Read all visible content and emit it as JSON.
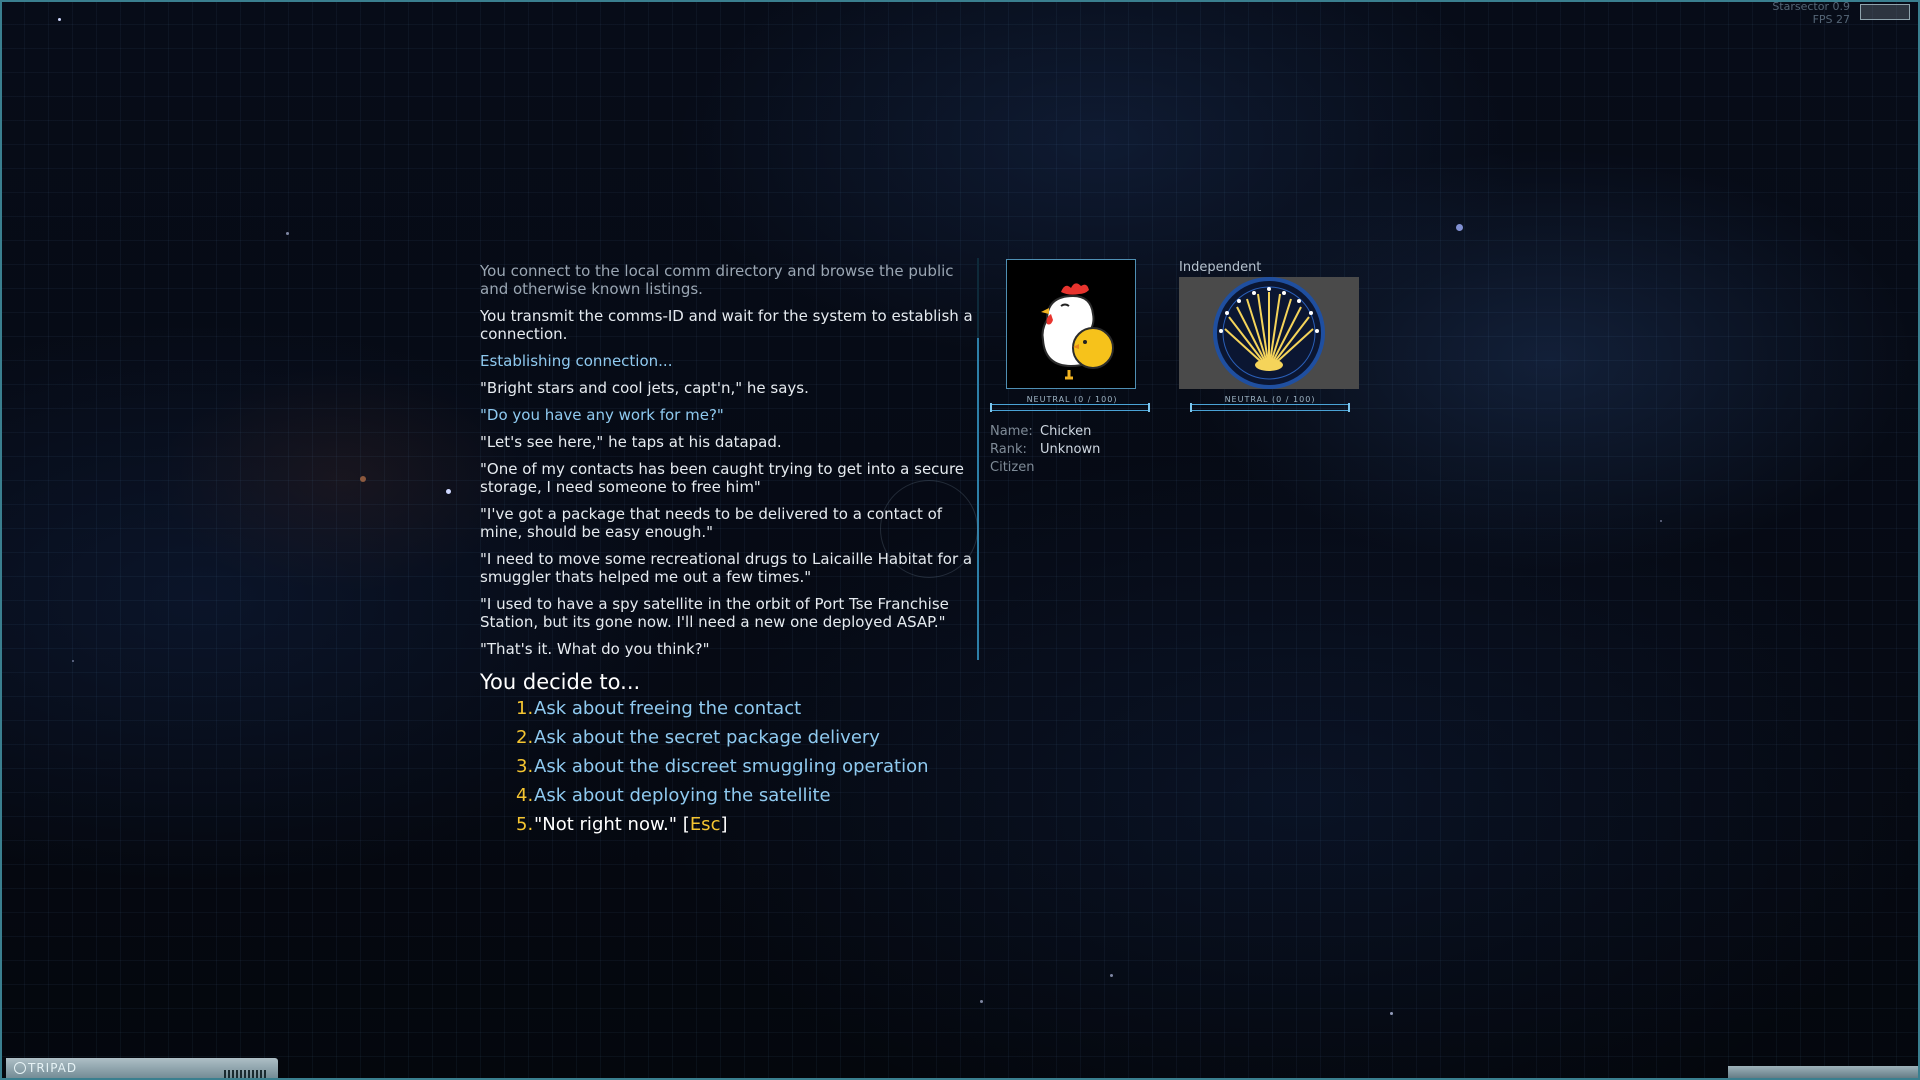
{
  "hud": {
    "debug_line1": "Starsector 0.9",
    "debug_line2": "FPS   27"
  },
  "dialog": {
    "log": [
      {
        "text": "You connect to the local comm directory and browse the public and otherwise known listings.",
        "style": "intro"
      },
      {
        "text": "You transmit the comms-ID and wait for the system to establish a connection.",
        "style": "normal"
      },
      {
        "text": "Establishing connection...",
        "style": "player"
      },
      {
        "text": "\"Bright stars and cool jets, capt'n,\" he says.",
        "style": "normal"
      },
      {
        "text": "\"Do you have any work for me?\"",
        "style": "player"
      },
      {
        "text": "\"Let's see here,\" he taps at his datapad.",
        "style": "normal"
      },
      {
        "text": "\"One of my contacts has been caught trying to get into a secure storage, I need someone to free him\"",
        "style": "normal"
      },
      {
        "text": "\"I've got a package that needs to be delivered to a contact of mine, should be easy enough.\"",
        "style": "normal"
      },
      {
        "text": "\"I need to move some recreational drugs to Laicaille Habitat for a smuggler thats helped me out a few times.\"",
        "style": "normal"
      },
      {
        "text": "\"I used to have a spy satellite in the orbit of Port Tse Franchise Station, but its gone now. I'll need a new one deployed ASAP.\"",
        "style": "normal"
      },
      {
        "text": "\"That's it. What do you think?\"",
        "style": "normal"
      }
    ],
    "decide_title": "You decide to...",
    "choices": [
      {
        "num": "1.",
        "text": "Ask about freeing the contact"
      },
      {
        "num": "2.",
        "text": "Ask about the secret package delivery"
      },
      {
        "num": "3.",
        "text": "Ask about the discreet smuggling operation"
      },
      {
        "num": "4.",
        "text": "Ask about deploying the satellite"
      }
    ],
    "exit_choice": {
      "num": "5.",
      "quote": "\"Not right now.\"",
      "open": "[",
      "key": "Esc",
      "close": "]"
    }
  },
  "contact": {
    "portrait_icon": "chicken-portrait",
    "reputation_label": "NEUTRAL (0 / 100)",
    "reputation_value": 0,
    "name_key": "Name:",
    "name_value": "Chicken",
    "rank_key": "Rank:",
    "rank_value": "Unknown",
    "post": "Citizen"
  },
  "faction": {
    "name": "Independent",
    "emblem_icon": "independent-sunburst-emblem",
    "reputation_label": "NEUTRAL (0 / 100)",
    "reputation_value": 0
  },
  "bottom_bar": {
    "label": "TRIPAD"
  },
  "colors": {
    "accent_cyan": "#8fcaf0",
    "accent_yellow": "#f5c531",
    "frame": "#3a7f8f"
  }
}
